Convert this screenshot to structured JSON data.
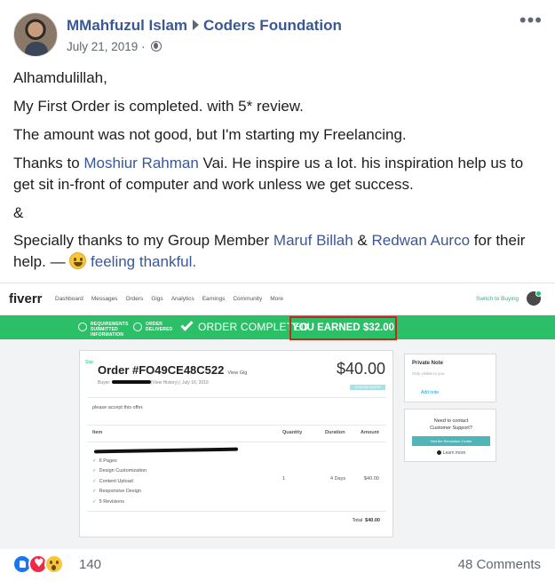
{
  "post": {
    "author": "MMahfuzul Islam",
    "group": "Coders Foundation",
    "date": "July 21, 2019",
    "date_separator": "·",
    "more_icon": "more-dots-icon"
  },
  "body": {
    "greeting": "Alhamdulillah,",
    "line1": "My First Order is completed. with 5* review.",
    "line2": "The amount was not good, but I'm starting my Freelancing.",
    "line3_prefix": "Thanks to ",
    "line3_mention": "Moshiur Rahman",
    "line3_rest": " Vai. He inspire us a lot. his inspiration help us to get sit in-front of computer and work unless we get success.",
    "ampersand": "&",
    "line4_prefix": "Specially thanks to my Group Member ",
    "line4_mention1": "Maruf Billah",
    "line4_and": " & ",
    "line4_mention2": "Redwan Aurco",
    "line4_suffix": " for their help. — ",
    "feeling": " feeling thankful."
  },
  "screenshot": {
    "logo": "fiverr",
    "menu": [
      "Dashboard",
      "Messages",
      "Orders",
      "Gigs",
      "Analytics",
      "Earnings",
      "Community",
      "More"
    ],
    "switch_label": "Switch to Buying",
    "banner": {
      "step1": "REQUIREMENTS SUBMITTED INFORMATION",
      "step2": "ORDER DELIVERED",
      "main": "ORDER COMPLETED",
      "earned": "YOU EARNED $32.00",
      "accent_color": "#2bbf67",
      "highlight_color": "#c6271f"
    },
    "order": {
      "star": "Star",
      "title": "Order #FO49CE48C522",
      "view_gig": "View Gig",
      "buyer_label": "Buyer:",
      "view_history": "(View History)",
      "order_date": "| July 16, 2019",
      "price": "$40.00",
      "tag": "CUSTOM ORDER",
      "note": "please accept this offer.",
      "columns": [
        "Item",
        "Quantity",
        "Duration",
        "Amount"
      ],
      "features": [
        "6 Pages",
        "Design Customization",
        "Content Upload",
        "Responsive Design",
        "5 Revisions"
      ],
      "quantity": "1",
      "duration": "4 Days",
      "amount": "$40.00",
      "total_label": "Total",
      "total_value": "$40.00"
    },
    "private_note": {
      "title": "Private Note",
      "subtitle": "Only visible to you",
      "add": "Add note"
    },
    "support": {
      "line1": "Need to contact",
      "line2": "Customer Support?",
      "button": "Visit the Resolution Center",
      "learn": "Learn more"
    }
  },
  "footer": {
    "reaction_count": "140",
    "comments": "48 Comments",
    "reactions": [
      "like-icon",
      "love-icon",
      "wow-icon"
    ]
  }
}
